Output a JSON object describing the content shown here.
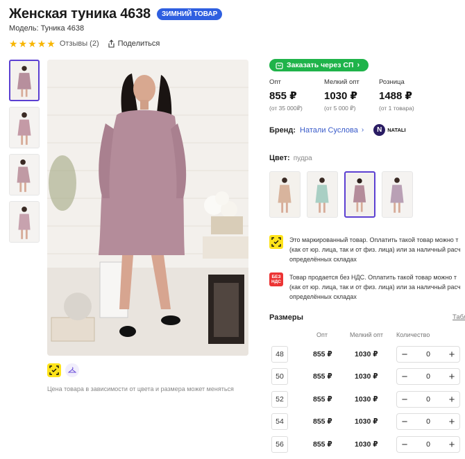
{
  "product": {
    "title": "Женская туника 4638",
    "badge": "ЗИМНИЙ ТОВАР",
    "model": "Модель: Туника 4638",
    "rating_stars": 5,
    "reviews": "Отзывы (2)",
    "share": "Поделиться"
  },
  "gallery": {
    "thumbnails": [
      "thumbnail-1",
      "thumbnail-2",
      "thumbnail-3",
      "thumbnail-4"
    ],
    "active_thumbnail": 1,
    "price_note": "Цена товара в зависимости от цвета и размера может меняться"
  },
  "order": {
    "button_label": "Заказать через СП"
  },
  "prices": [
    {
      "label": "Опт",
      "value": "855 ₽",
      "sub": "(от 35 000₽)"
    },
    {
      "label": "Мелкий опт",
      "value": "1030 ₽",
      "sub": "(от 5 000 ₽)"
    },
    {
      "label": "Розница",
      "value": "1488 ₽",
      "sub": "(от 1 товара)"
    }
  ],
  "brand": {
    "label": "Бренд:",
    "name": "Натали Суслова",
    "logo_text": "NATALI"
  },
  "color": {
    "label": "Цвет:",
    "value": "пудра",
    "swatches": [
      "beige",
      "mint",
      "pudra",
      "lilac"
    ],
    "active_swatch": 3
  },
  "notices": {
    "marked_lines": [
      "Это маркированный товар. Оплатить такой товар можно т",
      "(как от юр. лица, так и от физ. лица) или за наличный расч",
      "определённых складах"
    ],
    "nds_lines": [
      "Товар продается без НДС. Оплатить такой товар можно т",
      "(как от юр. лица, так и от физ. лица) или за наличный расч",
      "определённых складах"
    ],
    "nds_icon_text": "БЕЗ НДС"
  },
  "sizes": {
    "title": "Размеры",
    "table_link": "Табл",
    "columns": {
      "opt": "Опт",
      "small_opt": "Мелкий опт",
      "qty": "Количество"
    },
    "rows": [
      {
        "size": "48",
        "opt": "855 ₽",
        "small_opt": "1030 ₽",
        "qty": "0"
      },
      {
        "size": "50",
        "opt": "855 ₽",
        "small_opt": "1030 ₽",
        "qty": "0"
      },
      {
        "size": "52",
        "opt": "855 ₽",
        "small_opt": "1030 ₽",
        "qty": "0"
      },
      {
        "size": "54",
        "opt": "855 ₽",
        "small_opt": "1030 ₽",
        "qty": "0"
      },
      {
        "size": "56",
        "opt": "855 ₽",
        "small_opt": "1030 ₽",
        "qty": "0"
      }
    ]
  },
  "colors": {
    "accent": "#5b3fd1",
    "order_green": "#1fb34a",
    "badge_blue": "#2f5fe0",
    "star": "#f7b500",
    "link": "#3759c9",
    "marking_yellow": "#ffe31a",
    "nds_red": "#ec3434"
  }
}
